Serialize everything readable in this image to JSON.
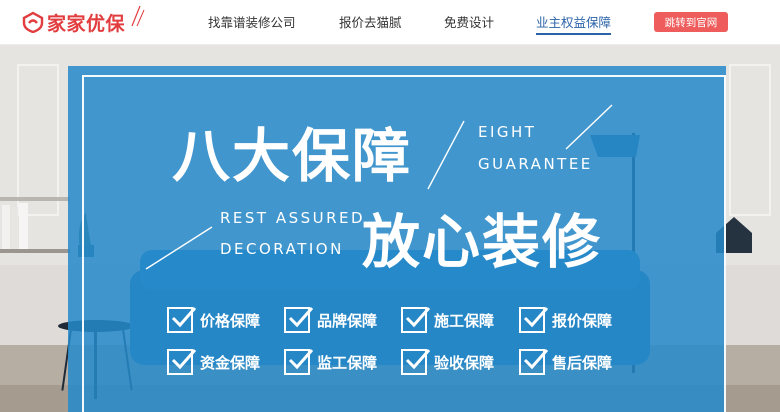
{
  "header": {
    "logo": {
      "text": "家家优保",
      "icon": "home-shield-logo-icon",
      "color": "#e23c3e"
    },
    "nav": [
      {
        "label": "找靠谱装修公司",
        "active": false
      },
      {
        "label": "报价去猫腻",
        "active": false
      },
      {
        "label": "免费设计",
        "active": false
      },
      {
        "label": "业主权益保障",
        "active": true
      }
    ],
    "cta_label": "跳转到官网",
    "accent": "#2a63a8",
    "cta_color": "#ee5c5c"
  },
  "hero": {
    "title_main": "八大保障",
    "title_main_en_line1": "EIGHT",
    "title_main_en_line2": "GUARANTEE",
    "title_sub_en_line1": "REST ASSURED",
    "title_sub_en_line2": "DECORATION",
    "title_sub": "放心装修",
    "panel_color": "#2589c9",
    "guarantees": [
      "价格保障",
      "品牌保障",
      "施工保障",
      "报价保障",
      "资金保障",
      "监工保障",
      "验收保障",
      "售后保障"
    ]
  }
}
